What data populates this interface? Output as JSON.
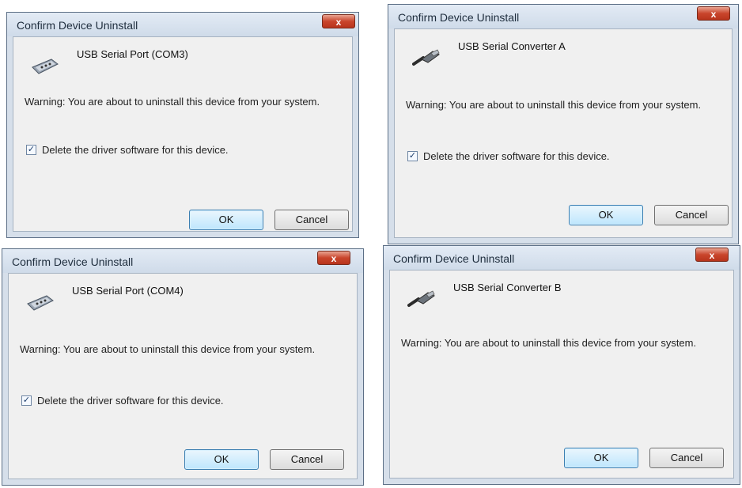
{
  "dialogs": [
    {
      "title": "Confirm Device Uninstall",
      "close_label": "x",
      "device_icon": "usb-serial-port-icon",
      "device_name": "USB Serial Port (COM3)",
      "warning": "Warning: You are about to uninstall this device from your system.",
      "checkbox_label": "Delete the driver software for this device.",
      "checkbox_checked": true,
      "ok_label": "OK",
      "cancel_label": "Cancel"
    },
    {
      "title": "Confirm Device Uninstall",
      "close_label": "x",
      "device_icon": "usb-connector-icon",
      "device_name": "USB Serial Converter A",
      "warning": "Warning: You are about to uninstall this device from your system.",
      "checkbox_label": "Delete the driver software for this device.",
      "checkbox_checked": true,
      "ok_label": "OK",
      "cancel_label": "Cancel"
    },
    {
      "title": "Confirm Device Uninstall",
      "close_label": "x",
      "device_icon": "usb-serial-port-icon",
      "device_name": "USB Serial Port (COM4)",
      "warning": "Warning: You are about to uninstall this device from your system.",
      "checkbox_label": "Delete the driver software for this device.",
      "checkbox_checked": true,
      "ok_label": "OK",
      "cancel_label": "Cancel"
    },
    {
      "title": "Confirm Device Uninstall",
      "close_label": "x",
      "device_icon": "usb-connector-icon",
      "device_name": "USB Serial Converter B",
      "warning": "Warning: You are about to uninstall this device from your system.",
      "ok_label": "OK",
      "cancel_label": "Cancel"
    }
  ],
  "colors": {
    "titlebar": "#d6dfea",
    "close_button": "#c9452c",
    "client_background": "#f0f0f0",
    "ok_button": "#bee6fd"
  }
}
